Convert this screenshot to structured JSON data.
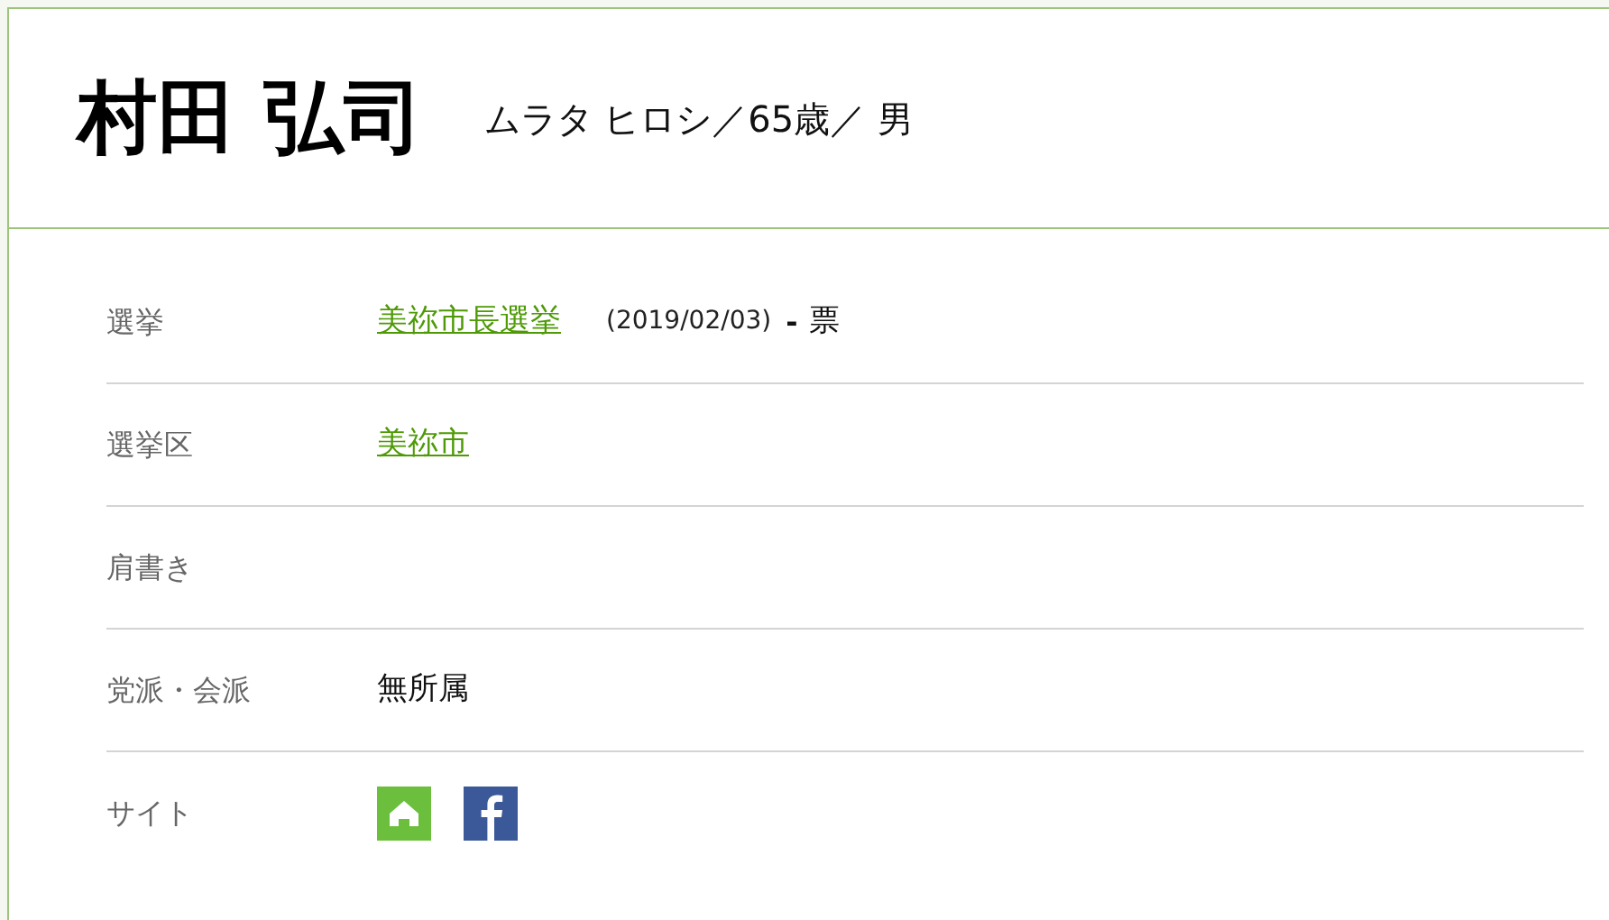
{
  "profile": {
    "name": "村田 弘司",
    "reading": "ムラタ ヒロシ／65歳／ 男"
  },
  "rows": [
    {
      "label": "選挙",
      "kind": "election",
      "link": "美祢市長選挙",
      "date": "(2019/02/03)",
      "votes": "-",
      "unit": "票"
    },
    {
      "label": "選挙区",
      "kind": "link",
      "link": "美祢市"
    },
    {
      "label": "肩書き",
      "kind": "empty"
    },
    {
      "label": "党派・会派",
      "kind": "text",
      "value": "無所属"
    },
    {
      "label": "サイト",
      "kind": "sites",
      "sites": [
        {
          "kind": "home"
        },
        {
          "kind": "facebook"
        }
      ]
    }
  ]
}
